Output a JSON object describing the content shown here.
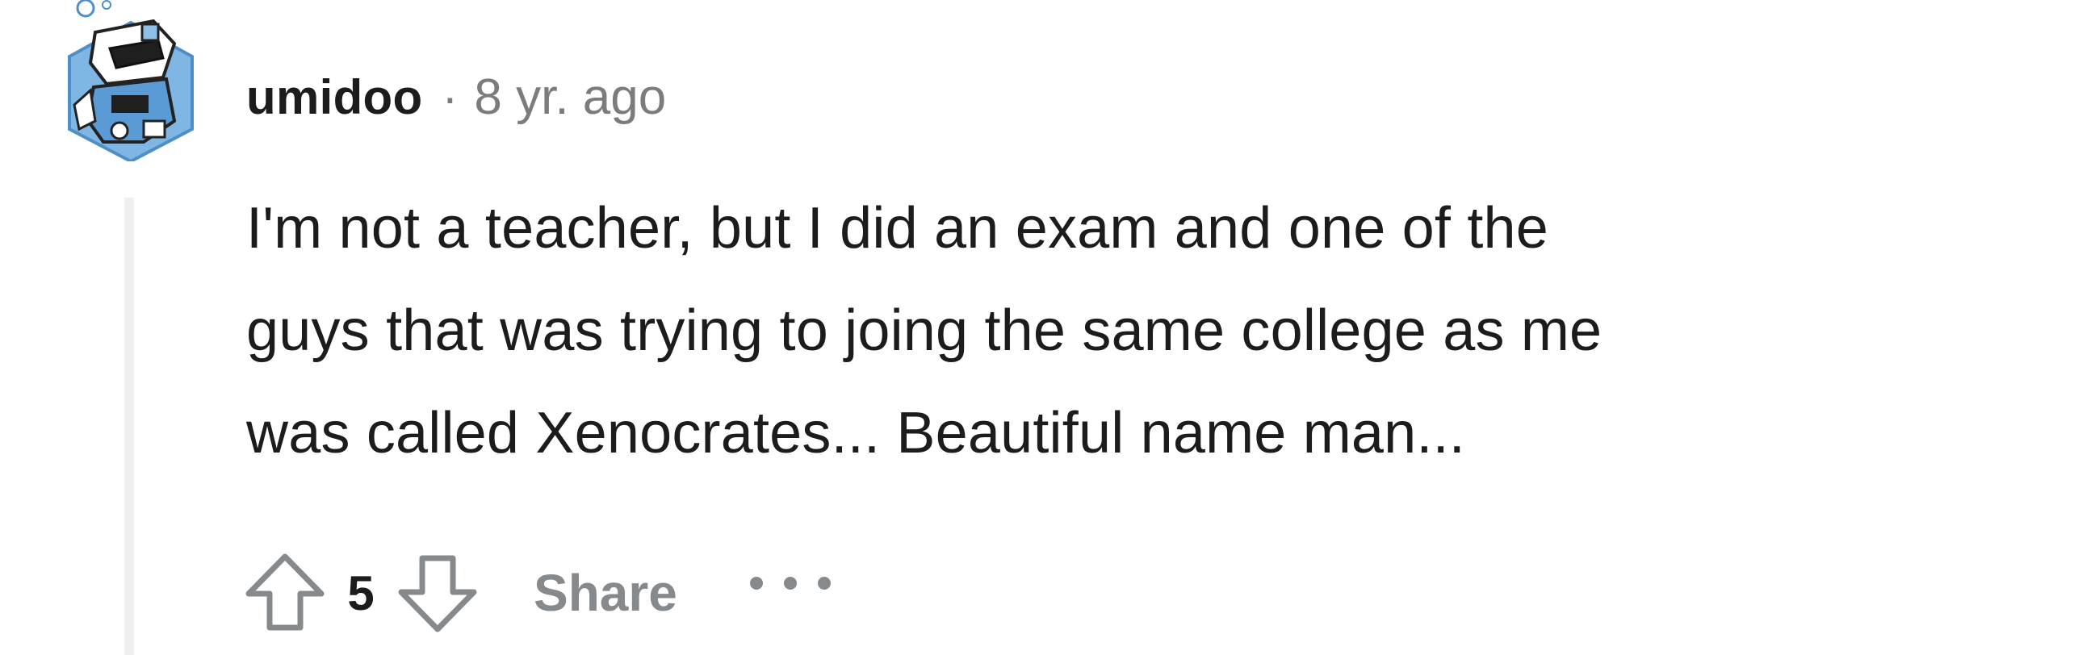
{
  "comment": {
    "author": "umidoo",
    "separator": "·",
    "timestamp": "8 yr. ago",
    "body_lines": [
      "I'm not a teacher, but I did an exam and one of the",
      "guys that was trying to joing the same college as me",
      "was called Xenocrates... Beautiful name man..."
    ],
    "score": "5",
    "share_label": "Share",
    "icons": {
      "avatar": "robot-avatar-icon",
      "upvote": "arrow-up-icon",
      "downvote": "arrow-down-icon",
      "more": "more-options-icon"
    },
    "colors": {
      "text": "#1c1c1c",
      "muted": "#7c7c7c",
      "action": "#878a8c",
      "thread_line": "#edeff1",
      "avatar_blue": "#5b9bd5"
    }
  }
}
